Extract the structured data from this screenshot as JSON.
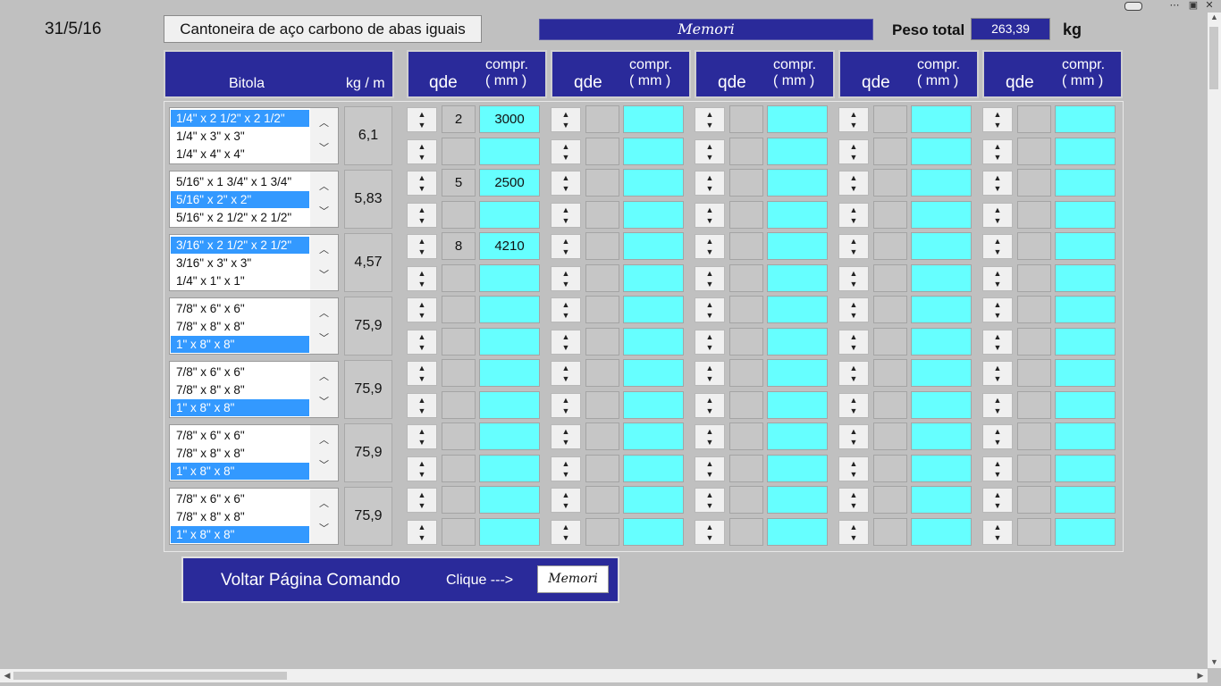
{
  "date": "31/5/16",
  "title_button": "Cantoneira de aço carbono de abas iguais",
  "memori_label": "Memori",
  "peso_total": {
    "label": "Peso total",
    "value": "263,39",
    "unit": "kg"
  },
  "headers": {
    "bitola": "Bitola",
    "kgm": "kg / m",
    "qde": "qde",
    "compr_line1": "compr.",
    "compr_line2": "( mm )"
  },
  "rows": [
    {
      "items": [
        "1/4\" x 2 1/2\" x 2 1/2\"",
        "1/4\" x 3\" x 3\"",
        "1/4\" x 4\" x 4\""
      ],
      "selected": 0,
      "kgm": "6,1",
      "entries": [
        [
          {
            "q": "2",
            "c": "3000"
          },
          {
            "q": "",
            "c": ""
          }
        ],
        [
          {
            "q": "",
            "c": ""
          },
          {
            "q": "",
            "c": ""
          }
        ],
        [
          {
            "q": "",
            "c": ""
          },
          {
            "q": "",
            "c": ""
          }
        ],
        [
          {
            "q": "",
            "c": ""
          },
          {
            "q": "",
            "c": ""
          }
        ],
        [
          {
            "q": "",
            "c": ""
          },
          {
            "q": "",
            "c": ""
          }
        ]
      ]
    },
    {
      "items": [
        "5/16\" x 1 3/4\" x 1 3/4\"",
        "5/16\" x 2\" x 2\"",
        "5/16\" x 2 1/2\" x 2 1/2\""
      ],
      "selected": 1,
      "kgm": "5,83",
      "entries": [
        [
          {
            "q": "5",
            "c": "2500"
          },
          {
            "q": "",
            "c": ""
          }
        ],
        [
          {
            "q": "",
            "c": ""
          },
          {
            "q": "",
            "c": ""
          }
        ],
        [
          {
            "q": "",
            "c": ""
          },
          {
            "q": "",
            "c": ""
          }
        ],
        [
          {
            "q": "",
            "c": ""
          },
          {
            "q": "",
            "c": ""
          }
        ],
        [
          {
            "q": "",
            "c": ""
          },
          {
            "q": "",
            "c": ""
          }
        ]
      ]
    },
    {
      "items": [
        "3/16\" x 2 1/2\" x 2 1/2\"",
        "3/16\" x 3\" x 3\"",
        "1/4\" x 1\" x 1\""
      ],
      "selected": 0,
      "kgm": "4,57",
      "entries": [
        [
          {
            "q": "8",
            "c": "4210"
          },
          {
            "q": "",
            "c": ""
          }
        ],
        [
          {
            "q": "",
            "c": ""
          },
          {
            "q": "",
            "c": ""
          }
        ],
        [
          {
            "q": "",
            "c": ""
          },
          {
            "q": "",
            "c": ""
          }
        ],
        [
          {
            "q": "",
            "c": ""
          },
          {
            "q": "",
            "c": ""
          }
        ],
        [
          {
            "q": "",
            "c": ""
          },
          {
            "q": "",
            "c": ""
          }
        ]
      ]
    },
    {
      "items": [
        "7/8\" x 6\" x 6\"",
        "7/8\" x 8\" x 8\"",
        "1\" x 8\" x 8\""
      ],
      "selected": 2,
      "kgm": "75,9",
      "entries": [
        [
          {
            "q": "",
            "c": ""
          },
          {
            "q": "",
            "c": ""
          }
        ],
        [
          {
            "q": "",
            "c": ""
          },
          {
            "q": "",
            "c": ""
          }
        ],
        [
          {
            "q": "",
            "c": ""
          },
          {
            "q": "",
            "c": ""
          }
        ],
        [
          {
            "q": "",
            "c": ""
          },
          {
            "q": "",
            "c": ""
          }
        ],
        [
          {
            "q": "",
            "c": ""
          },
          {
            "q": "",
            "c": ""
          }
        ]
      ]
    },
    {
      "items": [
        "7/8\" x 6\" x 6\"",
        "7/8\" x 8\" x 8\"",
        "1\" x 8\" x 8\""
      ],
      "selected": 2,
      "kgm": "75,9",
      "entries": [
        [
          {
            "q": "",
            "c": ""
          },
          {
            "q": "",
            "c": ""
          }
        ],
        [
          {
            "q": "",
            "c": ""
          },
          {
            "q": "",
            "c": ""
          }
        ],
        [
          {
            "q": "",
            "c": ""
          },
          {
            "q": "",
            "c": ""
          }
        ],
        [
          {
            "q": "",
            "c": ""
          },
          {
            "q": "",
            "c": ""
          }
        ],
        [
          {
            "q": "",
            "c": ""
          },
          {
            "q": "",
            "c": ""
          }
        ]
      ]
    },
    {
      "items": [
        "7/8\" x 6\" x 6\"",
        "7/8\" x 8\" x 8\"",
        "1\" x 8\" x 8\""
      ],
      "selected": 2,
      "kgm": "75,9",
      "entries": [
        [
          {
            "q": "",
            "c": ""
          },
          {
            "q": "",
            "c": ""
          }
        ],
        [
          {
            "q": "",
            "c": ""
          },
          {
            "q": "",
            "c": ""
          }
        ],
        [
          {
            "q": "",
            "c": ""
          },
          {
            "q": "",
            "c": ""
          }
        ],
        [
          {
            "q": "",
            "c": ""
          },
          {
            "q": "",
            "c": ""
          }
        ],
        [
          {
            "q": "",
            "c": ""
          },
          {
            "q": "",
            "c": ""
          }
        ]
      ]
    },
    {
      "items": [
        "7/8\" x 6\" x 6\"",
        "7/8\" x 8\" x 8\"",
        "1\" x 8\" x 8\""
      ],
      "selected": 2,
      "kgm": "75,9",
      "entries": [
        [
          {
            "q": "",
            "c": ""
          },
          {
            "q": "",
            "c": ""
          }
        ],
        [
          {
            "q": "",
            "c": ""
          },
          {
            "q": "",
            "c": ""
          }
        ],
        [
          {
            "q": "",
            "c": ""
          },
          {
            "q": "",
            "c": ""
          }
        ],
        [
          {
            "q": "",
            "c": ""
          },
          {
            "q": "",
            "c": ""
          }
        ],
        [
          {
            "q": "",
            "c": ""
          },
          {
            "q": "",
            "c": ""
          }
        ]
      ]
    }
  ],
  "footer": {
    "voltar": "Voltar Página Comando",
    "clique": "Clique --->",
    "button": "Memori"
  },
  "icons": {
    "spin_up": "chevron-up-icon",
    "spin_down": "chevron-down-icon",
    "window_more": "ellipsis-icon",
    "window_restore": "restore-icon",
    "window_close": "close-icon"
  },
  "colors": {
    "header_blue": "#2a2a9a",
    "cyan_input": "#66ffff",
    "selection": "#3399ff",
    "background": "#c0c0c0"
  }
}
